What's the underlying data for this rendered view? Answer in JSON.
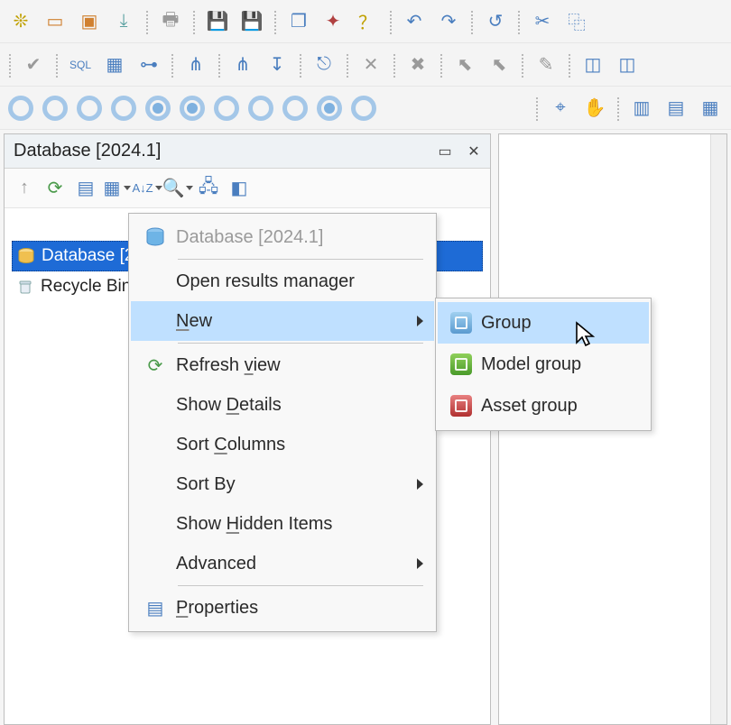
{
  "panel": {
    "title": "Database [2024.1]"
  },
  "tree": {
    "selected": "Database [2024.1]",
    "recycle": "Recycle Bin"
  },
  "context_menu": {
    "header": "Database [2024.1]",
    "open_results": "Open results manager",
    "new": "New",
    "refresh": "Refresh view",
    "show_details": "Show Details",
    "sort_columns": "Sort Columns",
    "sort_by": "Sort By",
    "show_hidden": "Show Hidden Items",
    "advanced": "Advanced",
    "properties": "Properties"
  },
  "new_submenu": {
    "group": "Group",
    "model_group": "Model group",
    "asset_group": "Asset group"
  }
}
